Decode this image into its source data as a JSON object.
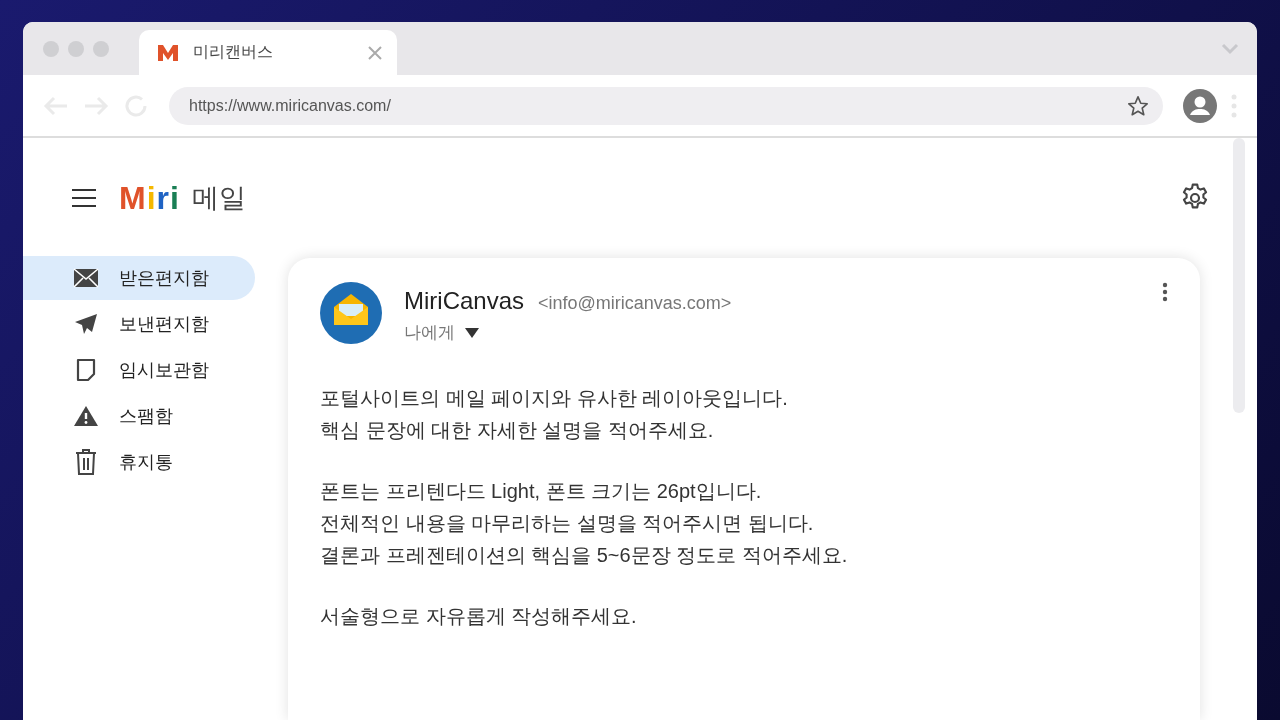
{
  "browser": {
    "tab_title": "미리캔버스",
    "url": "https://www.miricanvas.com/"
  },
  "app": {
    "logo": [
      {
        "text": "M",
        "color": "#e0522a"
      },
      {
        "text": "i",
        "color": "#f5b800"
      },
      {
        "text": "r",
        "color": "#1f63c4"
      },
      {
        "text": "i",
        "color": "#1a7f55"
      }
    ],
    "title": "메일"
  },
  "sidebar": {
    "items": [
      {
        "kind": "inbox",
        "label": "받은편지함",
        "selected": true
      },
      {
        "kind": "sent",
        "label": "보낸편지함",
        "selected": false
      },
      {
        "kind": "drafts",
        "label": "임시보관함",
        "selected": false
      },
      {
        "kind": "spam",
        "label": "스팸함",
        "selected": false
      },
      {
        "kind": "trash",
        "label": "휴지통",
        "selected": false
      }
    ]
  },
  "message": {
    "sender": "MiriCanvas",
    "address": "<info@miricanvas.com>",
    "recipient": "나에게",
    "paragraphs": [
      [
        "포털사이트의 메일 페이지와 유사한 레이아웃입니다.",
        "핵심 문장에 대한 자세한 설명을 적어주세요."
      ],
      [
        "폰트는 프리텐다드 Light, 폰트 크기는 26pt입니다.",
        "전체적인 내용을 마무리하는 설명을 적어주시면 됩니다.",
        "결론과 프레젠테이션의 핵심을 5~6문장 정도로 적어주세요."
      ],
      [
        "서술형으로 자유롭게 작성해주세요."
      ]
    ]
  }
}
